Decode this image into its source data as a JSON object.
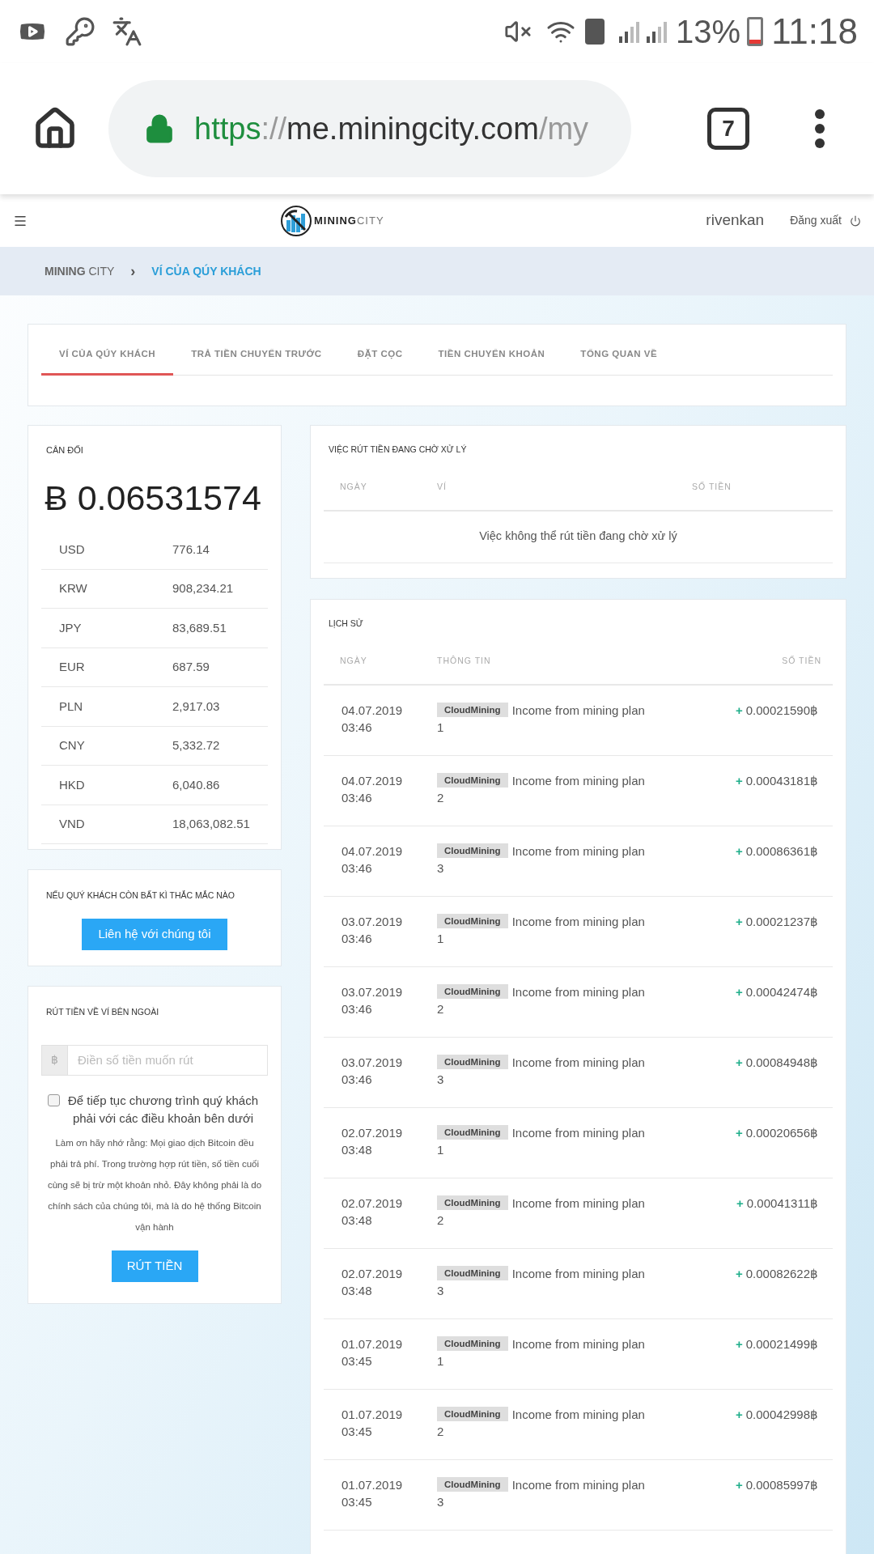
{
  "status_bar": {
    "battery": "13%",
    "time": "11:18"
  },
  "browser": {
    "url": [
      {
        "kind": "scheme",
        "text": "https"
      },
      {
        "kind": "sep",
        "text": "://"
      },
      {
        "kind": "host",
        "text": "me.miningcity.com"
      },
      {
        "kind": "path",
        "text": "/my"
      }
    ],
    "tab_count": "7"
  },
  "header": {
    "logo": {
      "bold": "MINING",
      "light": "CITY"
    },
    "username": "rivenkan",
    "logout": "Đăng xuất"
  },
  "breadcrumb": [
    {
      "bold": "MINING",
      "light": "CITY",
      "selected": false
    },
    {
      "label": "›",
      "kind": "sep"
    },
    {
      "label": "VÍ CỦA QÚY KHÁCH",
      "selected": true
    }
  ],
  "tabs": [
    {
      "label": "VÍ CỦA QÚY KHÁCH",
      "selected": true
    },
    {
      "label": "TRẢ TIỀN CHUYỂN TRƯỚC",
      "selected": false
    },
    {
      "label": "ĐẶT CỌC",
      "selected": false
    },
    {
      "label": "TIỀN CHUYỂN KHOẢN",
      "selected": false
    },
    {
      "label": "TỔNG QUAN VỀ",
      "selected": false
    }
  ],
  "balance": {
    "title": "CÂN ĐỐI",
    "symbol": "Ƀ",
    "amount": "0.06531574",
    "rates": [
      {
        "currency": "USD",
        "value": "776.14"
      },
      {
        "currency": "KRW",
        "value": "908,234.21"
      },
      {
        "currency": "JPY",
        "value": "83,689.51"
      },
      {
        "currency": "EUR",
        "value": "687.59"
      },
      {
        "currency": "PLN",
        "value": "2,917.03"
      },
      {
        "currency": "CNY",
        "value": "5,332.72"
      },
      {
        "currency": "HKD",
        "value": "6,040.86"
      },
      {
        "currency": "VND",
        "value": "18,063,082.51"
      }
    ]
  },
  "contact": {
    "title": "NẾU QUÝ KHÁCH CÒN BẤT KÌ THẮC MẮC NÀO",
    "button": "Liên hệ với chúng tôi"
  },
  "withdraw": {
    "title": "RÚT TIỀN VỀ VÍ BÊN NGOÀI",
    "prefix": "฿",
    "placeholder": "Điền số tiền muốn rút",
    "checked": false,
    "agree": "Để tiếp tục chương trình quý khách phải với các điều khoản bên dưới",
    "note": "Làm ơn hãy nhớ rằng: Mọi giao dịch Bitcoin đều phải trả phí. Trong trường hợp rút tiền, số tiền cuối cùng sẽ bị trừ một khoản nhỏ. Đây không phải là do chính sách của chúng tôi, mà là do hệ thống Bitcoin vận hành",
    "button": "RÚT TIỀN"
  },
  "pending": {
    "title": "VIỆC RÚT TIỀN ĐANG CHỜ XỬ LÝ",
    "columns": [
      "NGÀY",
      "VÍ",
      "SỐ TIỀN"
    ],
    "empty": "Việc không thể rút tiền đang chờ xử lý"
  },
  "history": {
    "title": "LỊCH SỬ",
    "columns": [
      "NGÀY",
      "THÔNG TIN",
      "SỐ TIỀN"
    ],
    "rows": [
      {
        "date": "04.07.2019",
        "time": "03:46",
        "tag": "CloudMining",
        "info": "Income from mining plan",
        "plan": "1",
        "sign": "+",
        "amount": "0.00021590฿"
      },
      {
        "date": "04.07.2019",
        "time": "03:46",
        "tag": "CloudMining",
        "info": "Income from mining plan",
        "plan": "2",
        "sign": "+",
        "amount": "0.00043181฿"
      },
      {
        "date": "04.07.2019",
        "time": "03:46",
        "tag": "CloudMining",
        "info": "Income from mining plan",
        "plan": "3",
        "sign": "+",
        "amount": "0.00086361฿"
      },
      {
        "date": "03.07.2019",
        "time": "03:46",
        "tag": "CloudMining",
        "info": "Income from mining plan",
        "plan": "1",
        "sign": "+",
        "amount": "0.00021237฿"
      },
      {
        "date": "03.07.2019",
        "time": "03:46",
        "tag": "CloudMining",
        "info": "Income from mining plan",
        "plan": "2",
        "sign": "+",
        "amount": "0.00042474฿"
      },
      {
        "date": "03.07.2019",
        "time": "03:46",
        "tag": "CloudMining",
        "info": "Income from mining plan",
        "plan": "3",
        "sign": "+",
        "amount": "0.00084948฿"
      },
      {
        "date": "02.07.2019",
        "time": "03:48",
        "tag": "CloudMining",
        "info": "Income from mining plan",
        "plan": "1",
        "sign": "+",
        "amount": "0.00020656฿"
      },
      {
        "date": "02.07.2019",
        "time": "03:48",
        "tag": "CloudMining",
        "info": "Income from mining plan",
        "plan": "2",
        "sign": "+",
        "amount": "0.00041311฿"
      },
      {
        "date": "02.07.2019",
        "time": "03:48",
        "tag": "CloudMining",
        "info": "Income from mining plan",
        "plan": "3",
        "sign": "+",
        "amount": "0.00082622฿"
      },
      {
        "date": "01.07.2019",
        "time": "03:45",
        "tag": "CloudMining",
        "info": "Income from mining plan",
        "plan": "1",
        "sign": "+",
        "amount": "0.00021499฿"
      },
      {
        "date": "01.07.2019",
        "time": "03:45",
        "tag": "CloudMining",
        "info": "Income from mining plan",
        "plan": "2",
        "sign": "+",
        "amount": "0.00042998฿"
      },
      {
        "date": "01.07.2019",
        "time": "03:45",
        "tag": "CloudMining",
        "info": "Income from mining plan",
        "plan": "3",
        "sign": "+",
        "amount": "0.00085997฿"
      }
    ]
  }
}
